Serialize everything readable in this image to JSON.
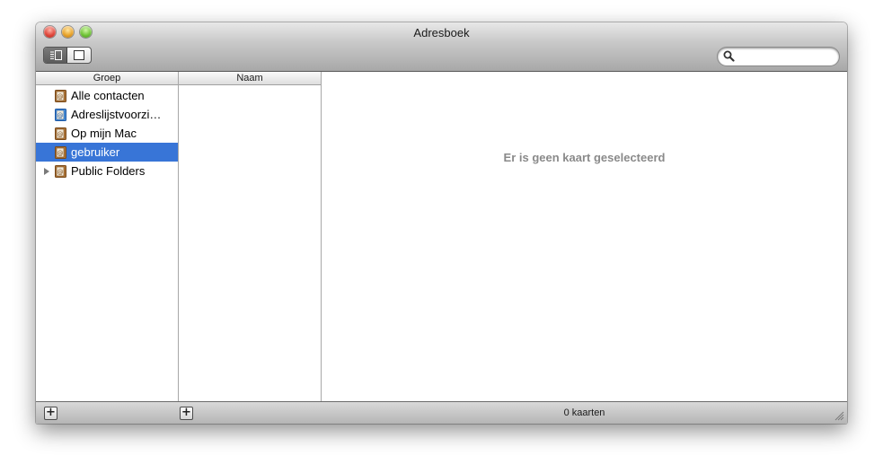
{
  "window": {
    "title": "Adresboek"
  },
  "toolbar": {
    "view_modes": [
      "card-and-column",
      "card-only"
    ],
    "active_view": "card-and-column",
    "search": {
      "value": "",
      "placeholder": ""
    }
  },
  "groups": {
    "header": "Groep",
    "items": [
      {
        "label": "Alle contacten",
        "icon": "address-book-icon",
        "selected": false,
        "disclosure": false
      },
      {
        "label": "Adreslijstvoorzi…",
        "icon": "directory-book-icon",
        "selected": false,
        "disclosure": false
      },
      {
        "label": "Op mijn Mac",
        "icon": "address-book-icon",
        "selected": false,
        "disclosure": false
      },
      {
        "label": "gebruiker",
        "icon": "address-book-icon",
        "selected": true,
        "disclosure": false
      },
      {
        "label": "Public Folders",
        "icon": "address-book-icon",
        "selected": false,
        "disclosure": true
      }
    ]
  },
  "names": {
    "header": "Naam",
    "items": []
  },
  "card": {
    "empty_message": "Er is geen kaart geselecteerd"
  },
  "status": {
    "card_count": "0 kaarten"
  },
  "colors": {
    "selection": "#3875d7",
    "empty_text": "#8a8a8a"
  }
}
